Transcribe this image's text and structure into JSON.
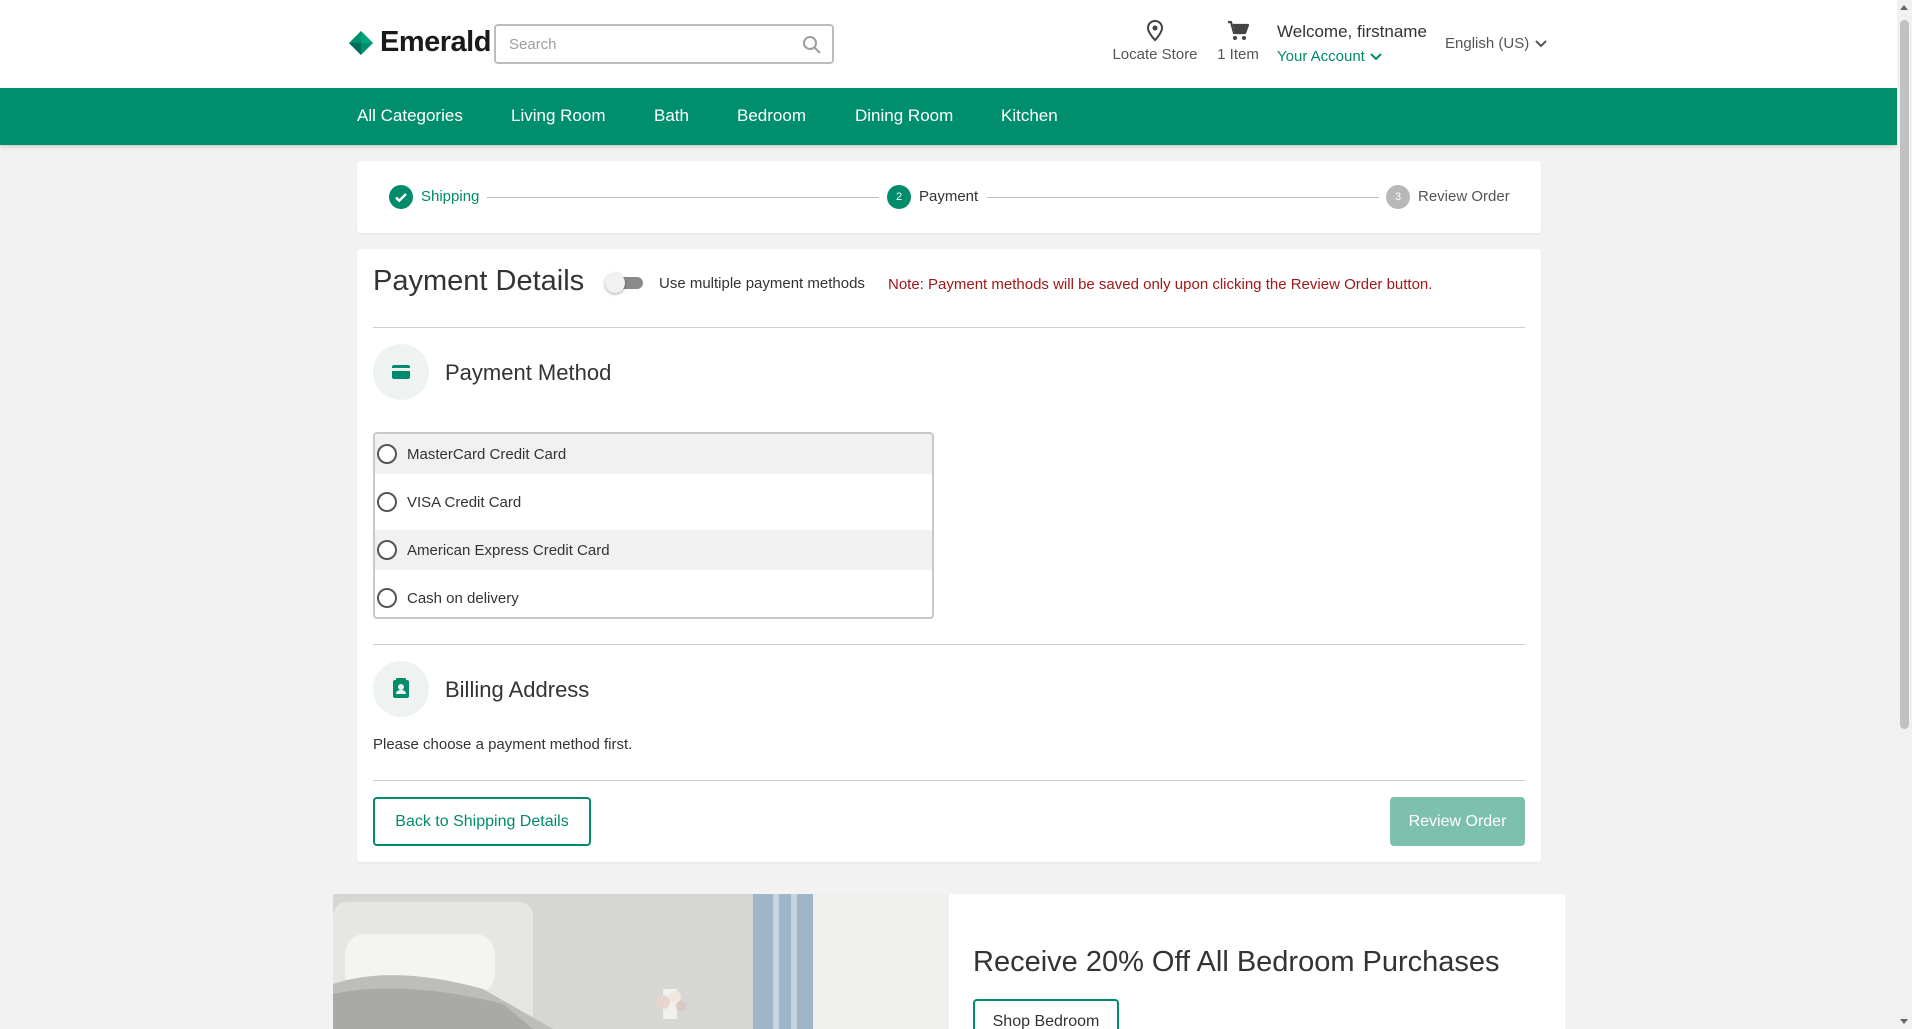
{
  "header": {
    "brand": "Emerald",
    "search_placeholder": "Search",
    "locate_store": "Locate Store",
    "cart_count": "1 Item",
    "welcome": "Welcome, firstname",
    "account": "Your Account",
    "language": "English (US)"
  },
  "nav": {
    "items": [
      "All Categories",
      "Living Room",
      "Bath",
      "Bedroom",
      "Dining Room",
      "Kitchen"
    ]
  },
  "stepper": {
    "steps": [
      {
        "label": "Shipping",
        "state": "complete"
      },
      {
        "number": "2",
        "label": "Payment",
        "state": "active"
      },
      {
        "number": "3",
        "label": "Review Order",
        "state": "pending"
      }
    ]
  },
  "payment": {
    "title": "Payment Details",
    "toggle_label": "Use multiple payment methods",
    "toggle_on": false,
    "note": "Note: Payment methods will be saved only upon clicking the Review Order button.",
    "method_title": "Payment Method",
    "methods": [
      "MasterCard Credit Card",
      "VISA Credit Card",
      "American Express Credit Card",
      "Cash on delivery"
    ],
    "billing_title": "Billing Address",
    "billing_message": "Please choose a payment method first.",
    "back_button": "Back to Shipping Details",
    "review_button": "Review Order"
  },
  "promo": {
    "title": "Receive 20% Off All Bedroom Purchases",
    "button": "Shop Bedroom"
  },
  "colors": {
    "brand_green": "#008f6d",
    "link_green": "#008b6b",
    "note_red": "#a01818",
    "review_disabled": "#7cc0ad"
  }
}
